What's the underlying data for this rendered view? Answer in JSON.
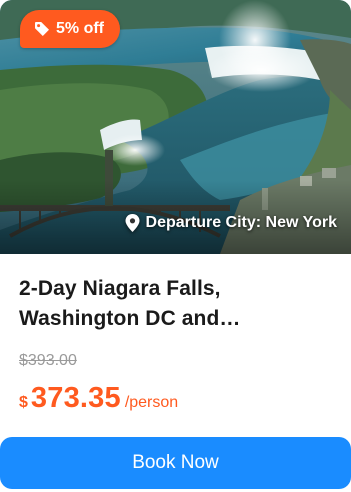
{
  "badge": {
    "icon": "tag-icon",
    "label": "5% off",
    "color": "#ff5a1f"
  },
  "hero": {
    "departure_icon": "location-pin-icon",
    "departure_label": "Departure City: New York"
  },
  "product": {
    "title": "2-Day Niagara Falls, Washington DC and…",
    "original_price": "$393.00",
    "currency_symbol": "$",
    "price": "373.35",
    "price_unit": "/person",
    "price_color": "#ff5a1f"
  },
  "cta": {
    "label": "Book Now",
    "color": "#1a8cff"
  }
}
